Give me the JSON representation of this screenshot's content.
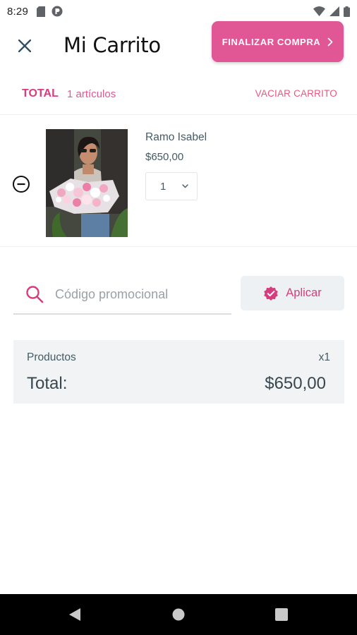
{
  "status_bar": {
    "time": "8:29"
  },
  "header": {
    "title": "Mi Carrito",
    "checkout_label": "FINALIZAR COMPRA"
  },
  "cart_summary_bar": {
    "total_label": "TOTAL",
    "items_count": "1 artículos",
    "empty_cart_label": "VACIAR CARRITO"
  },
  "cart_items": [
    {
      "name": "Ramo Isabel",
      "price": "$650,00",
      "quantity": "1"
    }
  ],
  "promo": {
    "placeholder": "Código promocional",
    "value": "",
    "apply_label": "Aplicar"
  },
  "summary": {
    "products_label": "Productos",
    "products_qty": "x1",
    "total_label": "Total:",
    "total_value": "$650,00"
  },
  "colors": {
    "accent": "#e15694",
    "accent_text": "#d63d7e",
    "summary_bg": "#f1f3f5",
    "text": "#455a64"
  },
  "icons": {
    "close": "close-icon",
    "checkout_arrow": "chevron-right-icon",
    "remove": "minus-circle-icon",
    "quantity_caret": "chevron-down-icon",
    "search": "search-icon",
    "apply": "verified-badge-icon",
    "nav_back": "back-triangle-icon",
    "nav_home": "home-circle-icon",
    "nav_recents": "recents-square-icon"
  }
}
